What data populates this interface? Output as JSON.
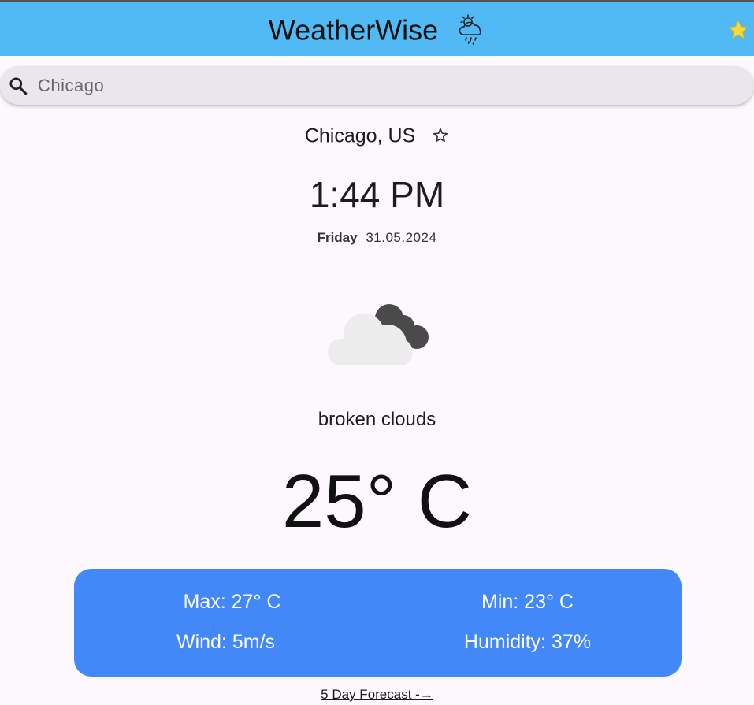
{
  "appbar": {
    "title": "WeatherWise",
    "title_icon": "cloud-sun-rain-icon",
    "favorites_icon": "star-filled-icon",
    "background_color": "#51b9f3",
    "star_color": "#fcd835"
  },
  "search": {
    "value": "Chicago",
    "icon": "search-icon"
  },
  "location": {
    "city": "Chicago, US",
    "favorite_icon": "star-outline-icon"
  },
  "time": "1:44 PM",
  "date": {
    "day": "Friday",
    "date": "31.05.2024"
  },
  "weather": {
    "icon": "broken-clouds-icon",
    "condition": "broken clouds",
    "temperature": "25° C"
  },
  "stats": {
    "max": "Max: 27° C",
    "min": "Min: 23° C",
    "wind": "Wind: 5m/s",
    "humidity": "Humidity: 37%",
    "card_color": "#4388f8"
  },
  "forecast_link": "5 Day Forecast -→"
}
